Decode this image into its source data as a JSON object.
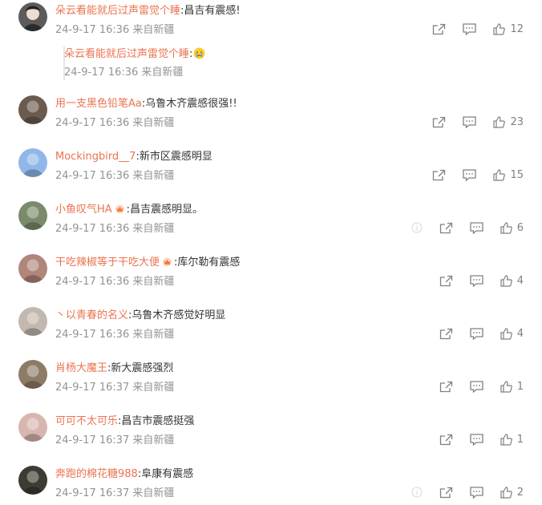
{
  "comments": [
    {
      "user": "朵云看能就后过声雷觉个睡",
      "text": "昌吉有震感!",
      "date": "24-9-17 16:36",
      "source": "来自新疆",
      "likes": "12",
      "avatar_color": "#5b5b5b",
      "reply": {
        "user": "朵云看能就后过声雷觉个睡",
        "date": "24-9-17 16:36",
        "source": "来自新疆"
      }
    },
    {
      "user": "用一支黑色铅笔Aa",
      "text": "乌鲁木齐震感很强!!",
      "date": "24-9-17 16:36",
      "source": "来自新疆",
      "likes": "23",
      "avatar_color": "#6b5a4e"
    },
    {
      "user": "Mockingbird__7",
      "text": "新市区震感明显",
      "date": "24-9-17 16:36",
      "source": "来自新疆",
      "likes": "15",
      "avatar_color": "#8fb8e8"
    },
    {
      "user": "小鱼叹气HA",
      "text": "昌吉震感明显。",
      "date": "24-9-17 16:36",
      "source": "来自新疆",
      "likes": "6",
      "avatar_color": "#7a8a6a"
    },
    {
      "user": "干吃辣椒等于干吃大便",
      "text": "库尔勒有震感",
      "date": "24-9-17 16:36",
      "source": "来自新疆",
      "likes": "4",
      "avatar_color": "#b0857a"
    },
    {
      "user": "丶以青春的名义",
      "text": "乌鲁木齐感觉好明显",
      "date": "24-9-17 16:36",
      "source": "来自新疆",
      "likes": "4",
      "avatar_color": "#c2b8ae"
    },
    {
      "user": "肖杨大魔王",
      "text": "新大震感强烈",
      "date": "24-9-17 16:37",
      "source": "来自新疆",
      "likes": "1",
      "avatar_color": "#8d7b66"
    },
    {
      "user": "可可不太可乐",
      "text": "昌吉市震感挺强",
      "date": "24-9-17 16:37",
      "source": "来自新疆",
      "likes": "1",
      "avatar_color": "#d8b6b0"
    },
    {
      "user": "奔跑的棉花糖988",
      "text": "阜康有震感",
      "date": "24-9-17 16:37",
      "source": "来自新疆",
      "likes": "2",
      "avatar_color": "#3e3a34"
    }
  ],
  "icons": {
    "share": "share-icon",
    "comment": "comment-icon",
    "like": "like-icon",
    "crown": "crown-badge-icon",
    "cry": "crying-emoji-icon",
    "info": "info-icon"
  }
}
